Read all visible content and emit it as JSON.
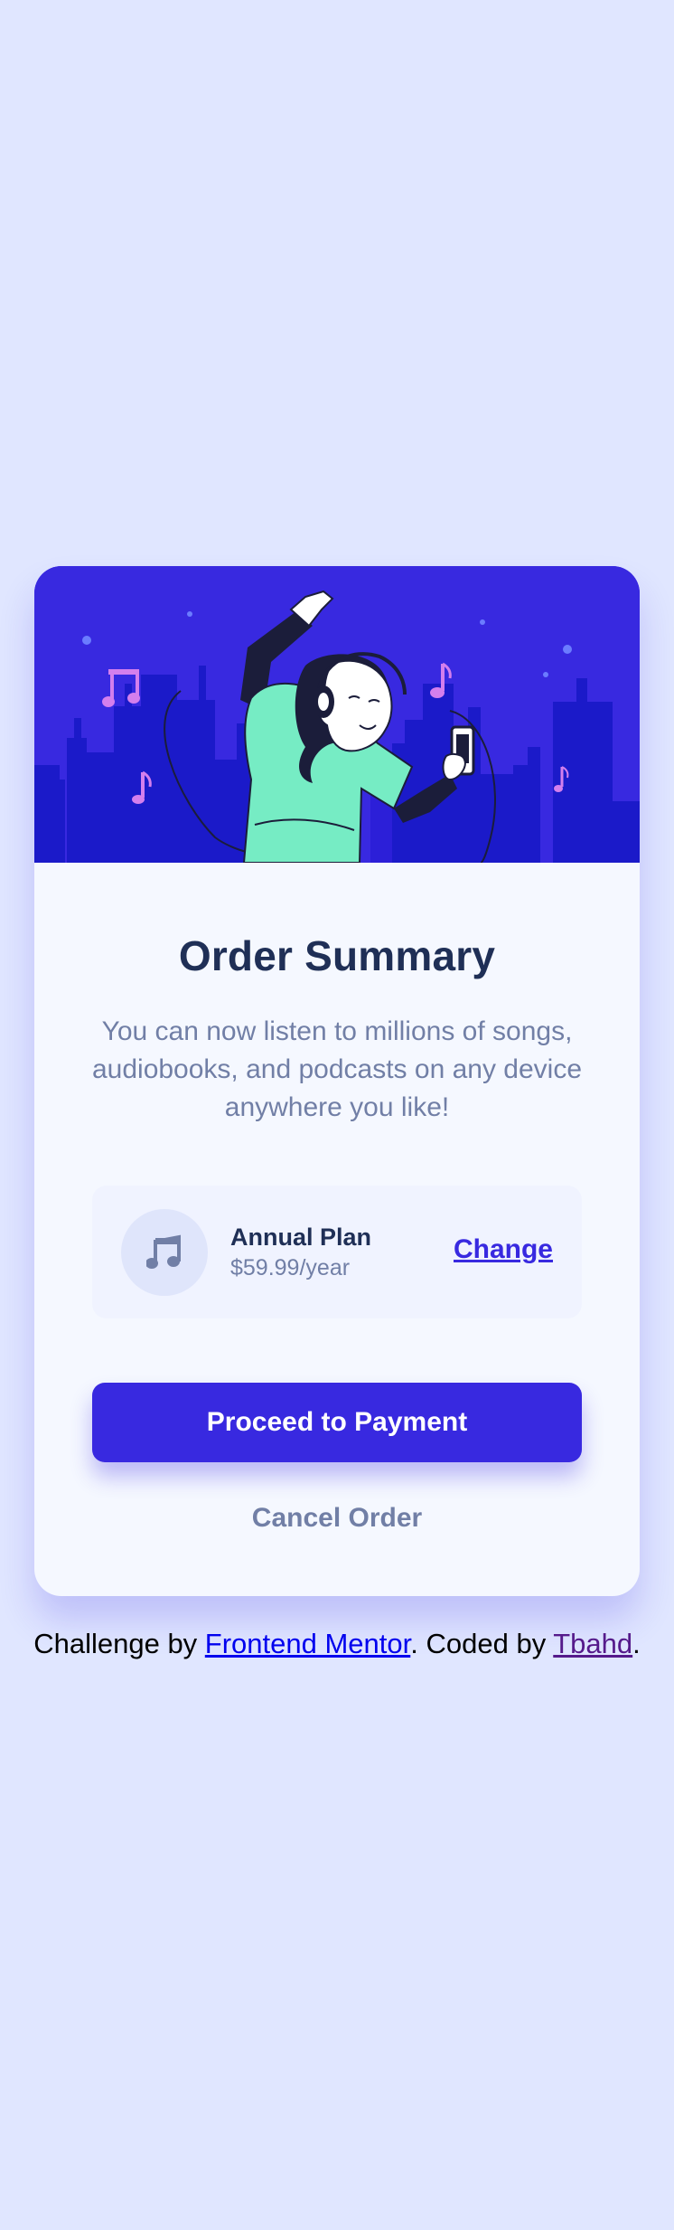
{
  "hero": {
    "background_color": "#3829e0",
    "illustration": "woman-dancing-with-headphones-and-phone"
  },
  "card": {
    "title": "Order Summary",
    "description": "You can now listen to millions of songs, audiobooks, and podcasts on any device anywhere you like!",
    "plan": {
      "icon": "music-note-icon",
      "name": "Annual Plan",
      "price": "$59.99/year",
      "change_label": "Change"
    },
    "proceed_label": "Proceed to Payment",
    "cancel_label": "Cancel Order"
  },
  "attribution": {
    "prefix": "Challenge by ",
    "provider": "Frontend Mentor",
    "middle": ". Coded by ",
    "author": "Tbahd",
    "suffix": "."
  },
  "colors": {
    "page_background": "#e0e6ff",
    "card_background": "#f5f8ff",
    "accent": "#3829e0",
    "heading": "#1f2f56",
    "muted_text": "#717fa6",
    "plan_box": "#f0f3ff"
  }
}
